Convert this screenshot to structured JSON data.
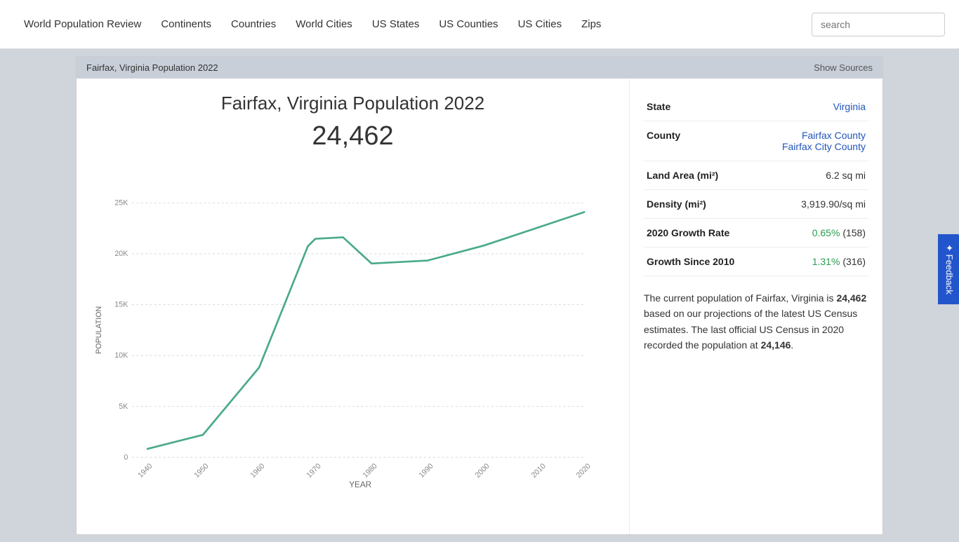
{
  "nav": {
    "brand": "World Population Review",
    "links": [
      {
        "label": "Continents",
        "name": "nav-continents"
      },
      {
        "label": "Countries",
        "name": "nav-countries"
      },
      {
        "label": "World Cities",
        "name": "nav-world-cities"
      },
      {
        "label": "US States",
        "name": "nav-us-states"
      },
      {
        "label": "US Counties",
        "name": "nav-us-counties"
      },
      {
        "label": "US Cities",
        "name": "nav-us-cities"
      },
      {
        "label": "Zips",
        "name": "nav-zips"
      }
    ],
    "search_placeholder": "search"
  },
  "header": {
    "title": "Fairfax, Virginia Population 2022",
    "show_sources": "Show Sources"
  },
  "chart": {
    "title": "Fairfax, Virginia Population 2022",
    "population": "24,462",
    "y_axis_label": "POPULATION",
    "x_axis_label": "YEAR",
    "y_labels": [
      "25K",
      "20K",
      "15K",
      "10K",
      "5K",
      "0"
    ],
    "x_labels": [
      "1940",
      "1950",
      "1960",
      "1970",
      "1980",
      "1990",
      "2000",
      "2010",
      "2020"
    ]
  },
  "info": {
    "state_label": "State",
    "state_value": "Virginia",
    "county_label": "County",
    "county_value1": "Fairfax County",
    "county_value2": "Fairfax City County",
    "land_label": "Land Area (mi²)",
    "land_value": "6.2 sq mi",
    "density_label": "Density (mi²)",
    "density_value": "3,919.90/sq mi",
    "growth_2020_label": "2020 Growth Rate",
    "growth_2020_value": "0.65%",
    "growth_2020_extra": "(158)",
    "growth_2010_label": "Growth Since 2010",
    "growth_2010_value": "1.31%",
    "growth_2010_extra": "(316)"
  },
  "description": {
    "text_before": "The current population of Fairfax, Virginia is ",
    "population_bold": "24,462",
    "text_middle": " based on our projections of the latest US Census estimates. The last official US Census in 2020 recorded the population at ",
    "census_bold": "24,146",
    "text_end": "."
  },
  "feedback": {
    "label": "✦ Feedback"
  }
}
